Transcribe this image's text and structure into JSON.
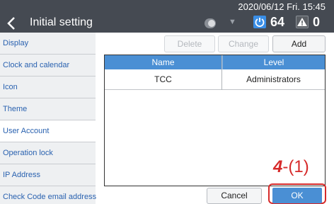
{
  "header": {
    "title": "Initial setting",
    "datetime": "2020/06/12 Fri. 15:45",
    "power_count": "64",
    "alarm_count": "0"
  },
  "sidebar": {
    "items": [
      {
        "label": "Display"
      },
      {
        "label": "Clock and calendar"
      },
      {
        "label": "Icon"
      },
      {
        "label": "Theme"
      },
      {
        "label": "User Account",
        "active": true
      },
      {
        "label": "Operation lock"
      },
      {
        "label": "IP Address"
      },
      {
        "label": "Check Code email address"
      }
    ]
  },
  "toolbar": {
    "delete_label": "Delete",
    "change_label": "Change",
    "add_label": "Add"
  },
  "table": {
    "columns": [
      "Name",
      "Level"
    ],
    "rows": [
      {
        "name": "TCC",
        "level": "Administrators"
      }
    ]
  },
  "footer": {
    "cancel_label": "Cancel",
    "ok_label": "OK"
  },
  "annotation": {
    "step": "4",
    "sub": "-(1)"
  },
  "colors": {
    "header_bg": "#454a52",
    "accent": "#4a8fd4",
    "highlight": "#d62a2a",
    "sidebar_text": "#2a62b0"
  }
}
